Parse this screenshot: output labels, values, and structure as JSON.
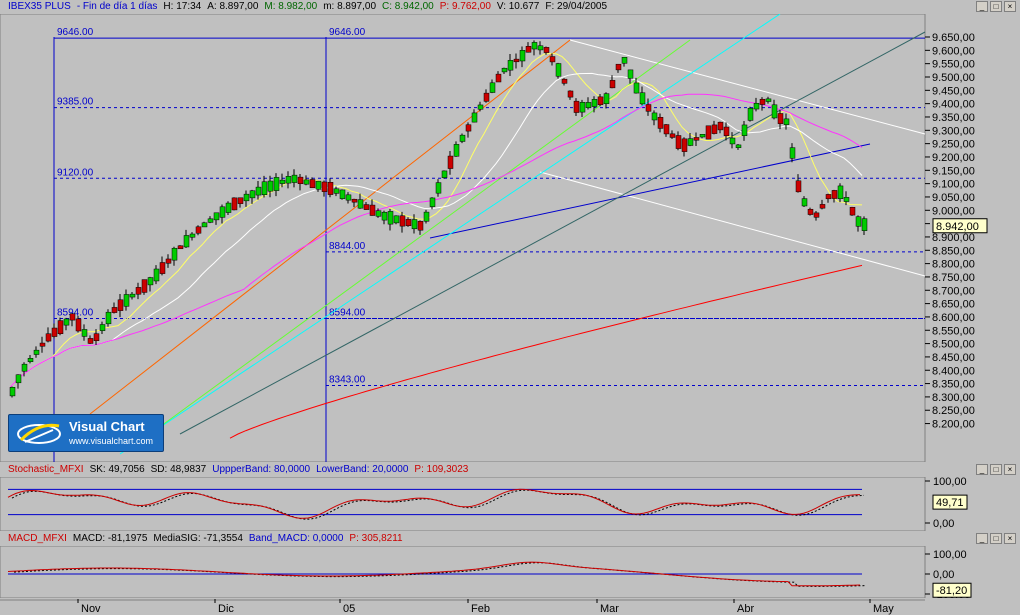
{
  "header": {
    "symbol": "IBEX35 PLUS",
    "timeframe": "- Fin de día 1 días",
    "H": "H: 17:34",
    "A": "A: 8.897,00",
    "M": "M: 8.982,00",
    "m": "m: 8.897,00",
    "C": "C: 8.942,00",
    "P": "P: 9.762,00",
    "V": "V: 10.677",
    "F": "F: 29/04/2005"
  },
  "colors": {
    "bg": "#c0c0c0",
    "up": "#00cc00",
    "down": "#cc0000",
    "guide": "#0000cc"
  },
  "main_chart": {
    "y_ticks": [
      "9.650,00",
      "9.600,00",
      "9.550,00",
      "9.500,00",
      "9.450,00",
      "9.400,00",
      "9.350,00",
      "9.300,00",
      "9.250,00",
      "9.200,00",
      "9.150,00",
      "9.100,00",
      "9.050,00",
      "9.000,00",
      "8.950,00",
      "8.900,00",
      "8.850,00",
      "8.800,00",
      "8.750,00",
      "8.700,00",
      "8.650,00",
      "8.600,00",
      "8.550,00",
      "8.500,00",
      "8.450,00",
      "8.400,00",
      "8.350,00",
      "8.300,00",
      "8.250,00",
      "8.200,00"
    ],
    "levels": [
      "9646.00",
      "9646.00",
      "9385.00",
      "9120.00",
      "8844.00",
      "8594.00",
      "8594.00",
      "8343.00"
    ],
    "current_price": "8.942,00"
  },
  "logo": {
    "title": "Visual Chart",
    "url": "www.visualchart.com"
  },
  "stochastic": {
    "header": {
      "name": "Stochastic_MFXI",
      "sk": "SK: 49,7056",
      "sd": "SD: 48,9837",
      "upper": "UppperBand: 80,0000",
      "lower": "LowerBand: 20,0000",
      "p": "P: 109,3023"
    },
    "y_ticks": [
      "100,00",
      "0,00"
    ],
    "current": "49,71"
  },
  "macd": {
    "header": {
      "name": "MACD_MFXI",
      "macd": "MACD: -81,1975",
      "signal": "MediaSIG: -71,3554",
      "band": "Band_MACD: 0,0000",
      "p": "P: 305,8211"
    },
    "y_ticks": [
      "100,00",
      "0,00",
      "-100,00"
    ],
    "current": "-81,20"
  },
  "x_axis": {
    "labels": [
      "Nov",
      "Dic",
      "05",
      "Feb",
      "Mar",
      "Abr",
      "May"
    ]
  }
}
